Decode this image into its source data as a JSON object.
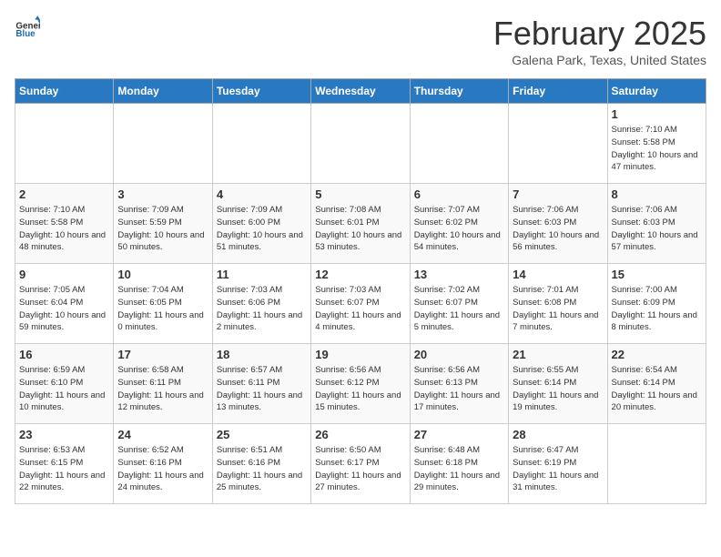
{
  "header": {
    "logo_general": "General",
    "logo_blue": "Blue",
    "month": "February 2025",
    "location": "Galena Park, Texas, United States"
  },
  "days_of_week": [
    "Sunday",
    "Monday",
    "Tuesday",
    "Wednesday",
    "Thursday",
    "Friday",
    "Saturday"
  ],
  "weeks": [
    [
      {
        "day": null
      },
      {
        "day": null
      },
      {
        "day": null
      },
      {
        "day": null
      },
      {
        "day": null
      },
      {
        "day": null
      },
      {
        "day": 1,
        "sunrise": "7:10 AM",
        "sunset": "5:58 PM",
        "daylight": "10 hours and 47 minutes."
      }
    ],
    [
      {
        "day": 2,
        "sunrise": "7:10 AM",
        "sunset": "5:58 PM",
        "daylight": "10 hours and 48 minutes."
      },
      {
        "day": 3,
        "sunrise": "7:09 AM",
        "sunset": "5:59 PM",
        "daylight": "10 hours and 50 minutes."
      },
      {
        "day": 4,
        "sunrise": "7:09 AM",
        "sunset": "6:00 PM",
        "daylight": "10 hours and 51 minutes."
      },
      {
        "day": 5,
        "sunrise": "7:08 AM",
        "sunset": "6:01 PM",
        "daylight": "10 hours and 53 minutes."
      },
      {
        "day": 6,
        "sunrise": "7:07 AM",
        "sunset": "6:02 PM",
        "daylight": "10 hours and 54 minutes."
      },
      {
        "day": 7,
        "sunrise": "7:06 AM",
        "sunset": "6:03 PM",
        "daylight": "10 hours and 56 minutes."
      },
      {
        "day": 8,
        "sunrise": "7:06 AM",
        "sunset": "6:03 PM",
        "daylight": "10 hours and 57 minutes."
      }
    ],
    [
      {
        "day": 9,
        "sunrise": "7:05 AM",
        "sunset": "6:04 PM",
        "daylight": "10 hours and 59 minutes."
      },
      {
        "day": 10,
        "sunrise": "7:04 AM",
        "sunset": "6:05 PM",
        "daylight": "11 hours and 0 minutes."
      },
      {
        "day": 11,
        "sunrise": "7:03 AM",
        "sunset": "6:06 PM",
        "daylight": "11 hours and 2 minutes."
      },
      {
        "day": 12,
        "sunrise": "7:03 AM",
        "sunset": "6:07 PM",
        "daylight": "11 hours and 4 minutes."
      },
      {
        "day": 13,
        "sunrise": "7:02 AM",
        "sunset": "6:07 PM",
        "daylight": "11 hours and 5 minutes."
      },
      {
        "day": 14,
        "sunrise": "7:01 AM",
        "sunset": "6:08 PM",
        "daylight": "11 hours and 7 minutes."
      },
      {
        "day": 15,
        "sunrise": "7:00 AM",
        "sunset": "6:09 PM",
        "daylight": "11 hours and 8 minutes."
      }
    ],
    [
      {
        "day": 16,
        "sunrise": "6:59 AM",
        "sunset": "6:10 PM",
        "daylight": "11 hours and 10 minutes."
      },
      {
        "day": 17,
        "sunrise": "6:58 AM",
        "sunset": "6:11 PM",
        "daylight": "11 hours and 12 minutes."
      },
      {
        "day": 18,
        "sunrise": "6:57 AM",
        "sunset": "6:11 PM",
        "daylight": "11 hours and 13 minutes."
      },
      {
        "day": 19,
        "sunrise": "6:56 AM",
        "sunset": "6:12 PM",
        "daylight": "11 hours and 15 minutes."
      },
      {
        "day": 20,
        "sunrise": "6:56 AM",
        "sunset": "6:13 PM",
        "daylight": "11 hours and 17 minutes."
      },
      {
        "day": 21,
        "sunrise": "6:55 AM",
        "sunset": "6:14 PM",
        "daylight": "11 hours and 19 minutes."
      },
      {
        "day": 22,
        "sunrise": "6:54 AM",
        "sunset": "6:14 PM",
        "daylight": "11 hours and 20 minutes."
      }
    ],
    [
      {
        "day": 23,
        "sunrise": "6:53 AM",
        "sunset": "6:15 PM",
        "daylight": "11 hours and 22 minutes."
      },
      {
        "day": 24,
        "sunrise": "6:52 AM",
        "sunset": "6:16 PM",
        "daylight": "11 hours and 24 minutes."
      },
      {
        "day": 25,
        "sunrise": "6:51 AM",
        "sunset": "6:16 PM",
        "daylight": "11 hours and 25 minutes."
      },
      {
        "day": 26,
        "sunrise": "6:50 AM",
        "sunset": "6:17 PM",
        "daylight": "11 hours and 27 minutes."
      },
      {
        "day": 27,
        "sunrise": "6:48 AM",
        "sunset": "6:18 PM",
        "daylight": "11 hours and 29 minutes."
      },
      {
        "day": 28,
        "sunrise": "6:47 AM",
        "sunset": "6:19 PM",
        "daylight": "11 hours and 31 minutes."
      },
      {
        "day": null
      }
    ]
  ]
}
